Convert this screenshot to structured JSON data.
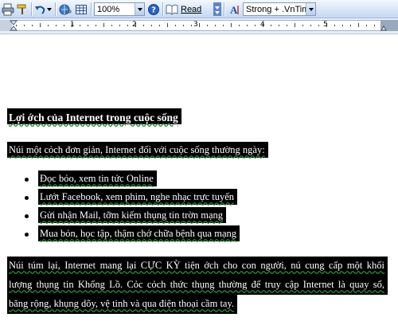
{
  "toolbar": {
    "zoom_value": "100%",
    "read_label": "Read",
    "style_value": "Strong + .VnTime"
  },
  "ruler": {
    "numbers": [
      "1",
      "2",
      "3",
      "4",
      "5"
    ]
  },
  "document": {
    "title": "Lợi ớch của Internet trong cuộc sống",
    "intro": "Núi một cỏch đơn giản, Internet đối với cuộc sống thường ngày:",
    "bullets": [
      "Đọc bỏo, xem tin tức Online",
      "Lướt Facebook, xem phim, nghe nhạc trực tuyến",
      "Gửi nhận Mail, tỡm kiếm thụng tin trờn mạng",
      "Mua bỏn, học tập, thậm chớ chữa bệnh qua mạng"
    ],
    "conclusion_lines": [
      "Núi túm lại, Internet mang lại CỰC KỲ tiện ớch cho con người, nú cung cấp một khối",
      "lượng thụng tin Khổng Lồ. Cỏc cỏch thức thụng thường để truy cập Internet là quay số,",
      "băng rộng, khụng dõy, vệ tinh và qua điện thoại cầm tay."
    ]
  },
  "colors": {
    "selection": "#000000",
    "text": "#ffffff",
    "toolbar": "#d6e4f7"
  }
}
